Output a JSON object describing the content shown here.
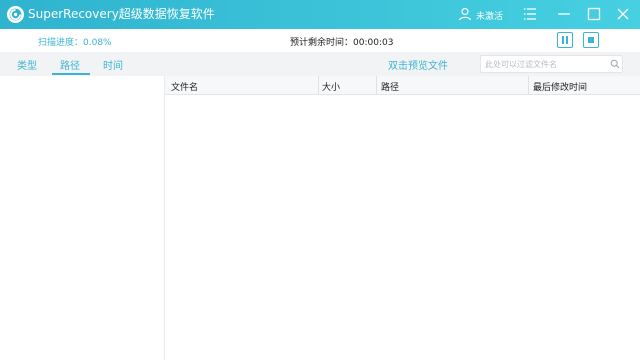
{
  "app": {
    "title": "SuperRecovery超级数据恢复软件",
    "user_label": "未激活",
    "accent_color": "#3db4d1",
    "titlebar_buttons": [
      "menu-icon",
      "minimize-icon",
      "maximize-icon",
      "close-icon"
    ]
  },
  "status": {
    "scan_progress": "扫描进度：0.08%",
    "eta": "预计剩余时间：00:00:03",
    "controls": [
      "pause-icon",
      "stop-icon"
    ]
  },
  "tabs": {
    "items": [
      {
        "label": "类型"
      },
      {
        "label": "路径"
      },
      {
        "label": "时间"
      }
    ],
    "active": "路径"
  },
  "toolbar": {
    "preview_hint": "双击预览文件",
    "filter_placeholder": "此处可以过滤文件名"
  },
  "table": {
    "columns": [
      "文件名",
      "大小",
      "路径",
      "最后修改时间"
    ],
    "rows": []
  }
}
